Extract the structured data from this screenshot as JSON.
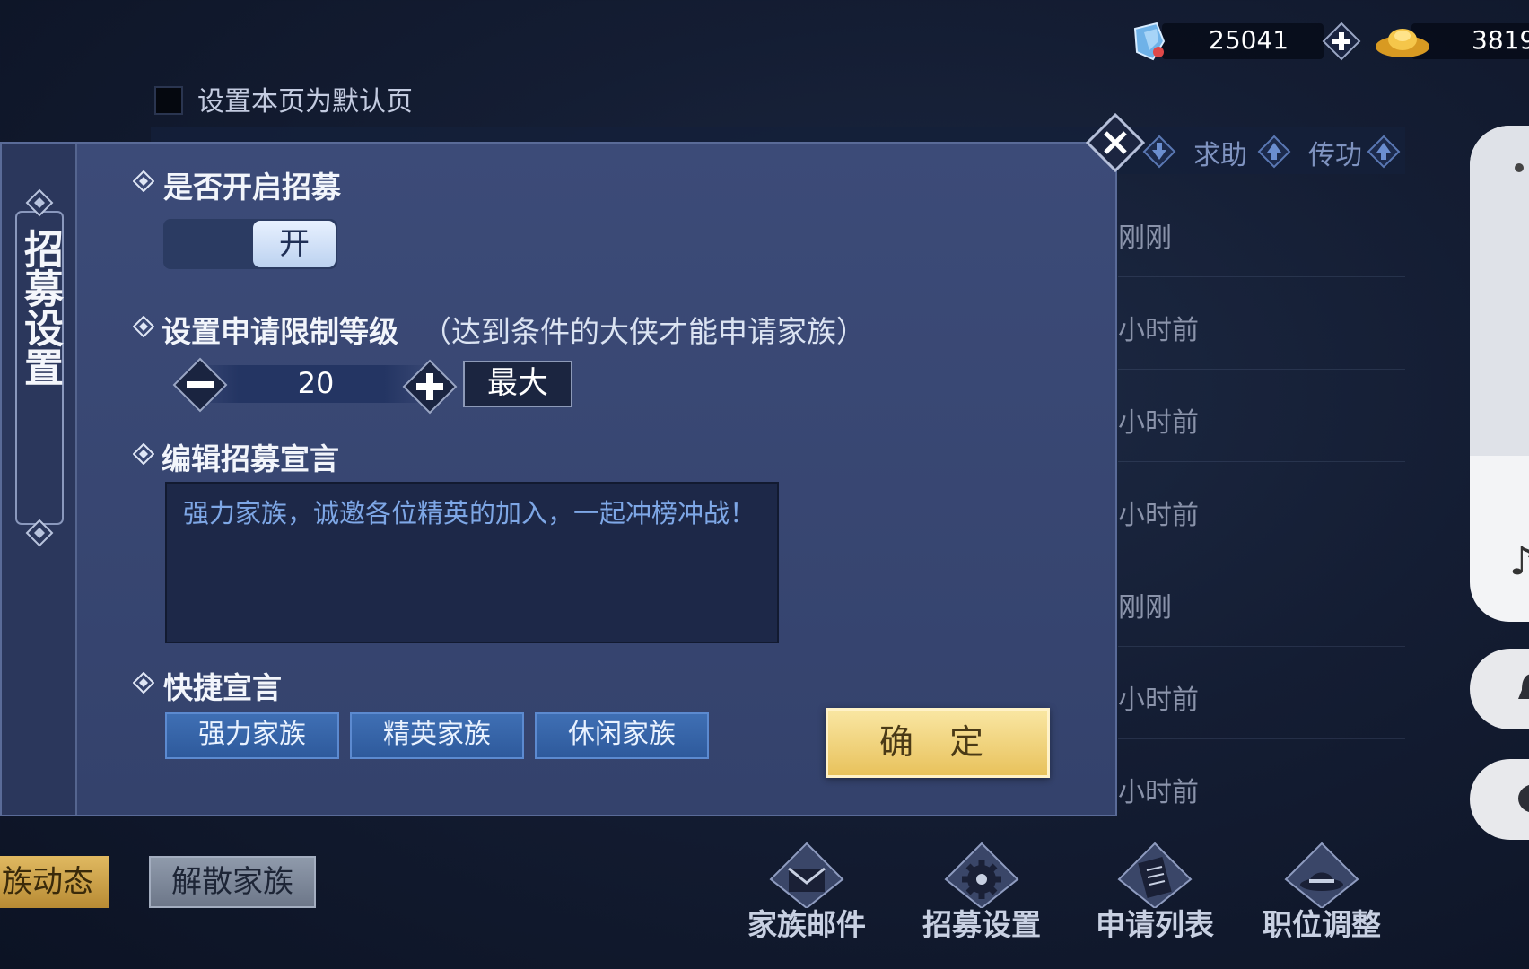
{
  "currency": {
    "gems": "25041",
    "gold": "3819"
  },
  "list": {
    "default_page_label": "设置本页为默认页",
    "header_cols": [
      {
        "label": "求助"
      },
      {
        "label": "传功"
      }
    ],
    "rows": [
      "刚刚",
      "小时前",
      "小时前",
      "小时前",
      "刚刚",
      "小时前",
      "小时前"
    ]
  },
  "modal": {
    "tab_label": "招募设置",
    "recruit_toggle": {
      "title": "是否开启招募",
      "state_label": "开"
    },
    "level_limit": {
      "title": "设置申请限制等级",
      "hint": "（达到条件的大侠才能申请家族）",
      "value": "20",
      "max_label": "最大"
    },
    "declaration": {
      "title": "编辑招募宣言",
      "text": "强力家族，诚邀各位精英的加入，一起冲榜冲战！"
    },
    "quick": {
      "title": "快捷宣言",
      "options": [
        "强力家族",
        "精英家族",
        "休闲家族"
      ]
    },
    "confirm_label": "确 定"
  },
  "bottom": {
    "dynamics_label": "族动态",
    "disband_label": "解散家族",
    "nav": [
      {
        "label": "家族邮件",
        "icon": "mail-icon"
      },
      {
        "label": "招募设置",
        "icon": "gear-icon"
      },
      {
        "label": "申请列表",
        "icon": "scroll-icon"
      },
      {
        "label": "职位调整",
        "icon": "hat-icon"
      }
    ]
  },
  "colors": {
    "modal_bg": "#3a4976",
    "confirm_gold": "#f1d27e",
    "quick_blue": "#3a68ab",
    "declaration_text": "#7ea7e6"
  }
}
